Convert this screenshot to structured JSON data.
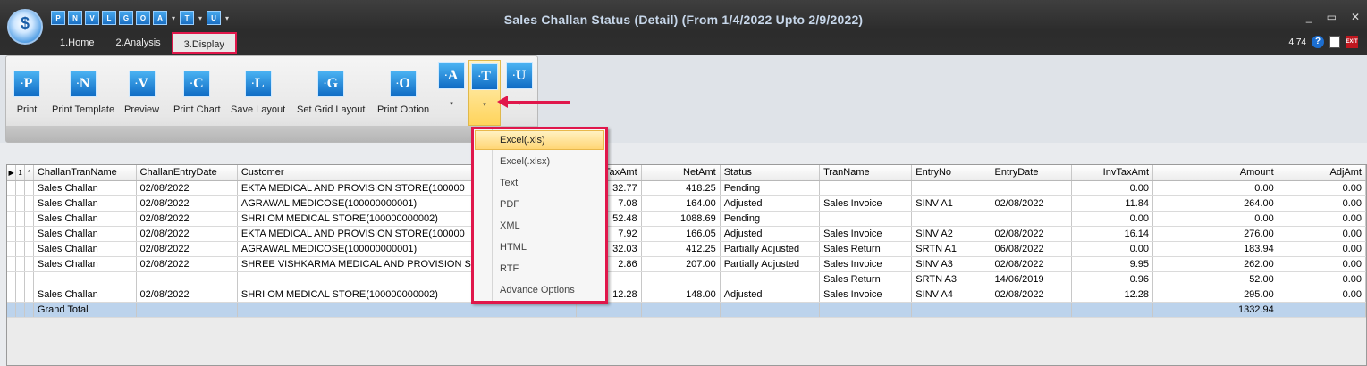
{
  "window": {
    "title": "Sales Challan Status (Detail)  (From 1/4/2022 Upto 2/9/2022)",
    "minimize": "_",
    "restore": "▭",
    "close": "✕"
  },
  "quick_access": [
    "P",
    "N",
    "V",
    "L",
    "G",
    "O",
    "A",
    "T",
    "U"
  ],
  "tabs": [
    "1.Home",
    "2.Analysis",
    "3.Display"
  ],
  "version": "4.74",
  "ribbon": {
    "buttons": [
      {
        "letter": "P",
        "label": "Print"
      },
      {
        "letter": "N",
        "label": "Print Template"
      },
      {
        "letter": "V",
        "label": "Preview"
      },
      {
        "letter": "C",
        "label": "Print Chart"
      },
      {
        "letter": "L",
        "label": "Save Layout"
      },
      {
        "letter": "G",
        "label": "Set Grid Layout"
      },
      {
        "letter": "O",
        "label": "Print Option"
      }
    ],
    "small": [
      {
        "letter": "A"
      },
      {
        "letter": "T"
      },
      {
        "letter": "U"
      }
    ]
  },
  "dropdown": {
    "items": [
      "Excel(.xls)",
      "Excel(.xlsx)",
      "Text",
      "PDF",
      "XML",
      "HTML",
      "RTF",
      "Advance Options"
    ]
  },
  "grid": {
    "indicator_headers": [
      "1",
      "*"
    ],
    "columns": [
      "ChallanTranName",
      "ChallanEntryDate",
      "Customer",
      "TaxAmt",
      "NetAmt",
      "Status",
      "TranName",
      "EntryNo",
      "EntryDate",
      "InvTaxAmt",
      "Amount",
      "AdjAmt"
    ],
    "rows": [
      [
        "Sales Challan",
        "02/08/2022",
        "EKTA MEDICAL AND PROVISION STORE(100000",
        "32.77",
        "418.25",
        "Pending",
        "",
        "",
        "",
        "0.00",
        "0.00",
        "0.00"
      ],
      [
        "Sales Challan",
        "02/08/2022",
        "AGRAWAL MEDICOSE(100000000001)",
        "7.08",
        "164.00",
        "Adjusted",
        "Sales Invoice",
        "SINV A1",
        "02/08/2022",
        "11.84",
        "264.00",
        "0.00"
      ],
      [
        "Sales Challan",
        "02/08/2022",
        "SHRI OM MEDICAL STORE(100000000002)",
        "52.48",
        "1088.69",
        "Pending",
        "",
        "",
        "",
        "0.00",
        "0.00",
        "0.00"
      ],
      [
        "Sales Challan",
        "02/08/2022",
        "EKTA MEDICAL AND PROVISION STORE(100000",
        "7.92",
        "166.05",
        "Adjusted",
        "Sales Invoice",
        "SINV A2",
        "02/08/2022",
        "16.14",
        "276.00",
        "0.00"
      ],
      [
        "Sales Challan",
        "02/08/2022",
        "AGRAWAL MEDICOSE(100000000001)",
        "32.03",
        "412.25",
        "Partially Adjusted",
        "Sales Return",
        "SRTN A1",
        "06/08/2022",
        "0.00",
        "183.94",
        "0.00"
      ],
      [
        "Sales Challan",
        "02/08/2022",
        "SHREE VISHKARMA MEDICAL AND PROVISION S",
        "2.86",
        "207.00",
        "Partially Adjusted",
        "Sales Invoice",
        "SINV A3",
        "02/08/2022",
        "9.95",
        "262.00",
        "0.00"
      ],
      [
        "",
        "",
        "",
        "",
        "",
        "",
        "Sales Return",
        "SRTN A3",
        "14/06/2019",
        "0.96",
        "52.00",
        "0.00"
      ],
      [
        "Sales Challan",
        "02/08/2022",
        "SHRI OM MEDICAL STORE(100000000002)",
        "12.28",
        "148.00",
        "Adjusted",
        "Sales Invoice",
        "SINV A4",
        "02/08/2022",
        "12.28",
        "295.00",
        "0.00"
      ]
    ],
    "total": {
      "label": "Grand Total",
      "amount": "1332.94"
    }
  },
  "colors": {
    "highlight": "#e0174b",
    "accent": "#1b6fc2",
    "total_row": "#bcd3ec"
  }
}
